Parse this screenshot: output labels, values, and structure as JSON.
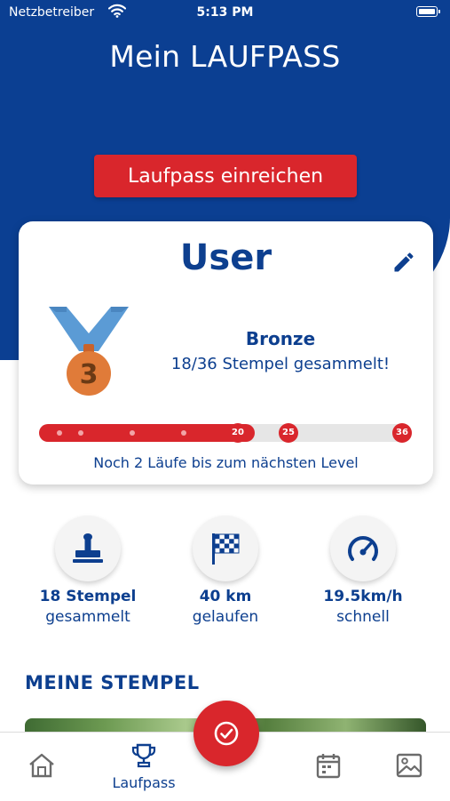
{
  "status_bar": {
    "carrier": "Netzbetreiber",
    "time": "5:13 PM"
  },
  "header": {
    "title": "Mein LAUFPASS",
    "submit_button": "Laufpass einreichen"
  },
  "profile": {
    "user_name": "User",
    "level": "Bronze",
    "level_number": "3",
    "stamps_text": "18/36 Stempel gesammelt!",
    "progress": {
      "current": 18,
      "max": 36,
      "milestones": [
        "20",
        "25",
        "36"
      ]
    },
    "next_level_hint": "Noch 2 Läufe bis zum nächsten Level"
  },
  "stats": [
    {
      "value": "18 Stempel",
      "label": "gesammelt",
      "icon": "stamp-icon"
    },
    {
      "value": "40 km",
      "label": "gelaufen",
      "icon": "checkered-flag-icon"
    },
    {
      "value": "19.5km/h",
      "label": "schnell",
      "icon": "speedometer-icon"
    }
  ],
  "stamps_section": {
    "title": "MEINE STEMPEL"
  },
  "tabbar": {
    "items": [
      {
        "icon": "home-icon",
        "label": ""
      },
      {
        "icon": "trophy-icon",
        "label": "Laufpass",
        "active": true
      },
      {
        "icon": "check-circle-icon",
        "label": ""
      },
      {
        "icon": "calendar-icon",
        "label": ""
      },
      {
        "icon": "image-icon",
        "label": ""
      }
    ]
  },
  "colors": {
    "primary": "#0b3f92",
    "accent": "#d9262c",
    "medal_ribbon": "#5b9bd5",
    "medal": "#e07b39"
  }
}
